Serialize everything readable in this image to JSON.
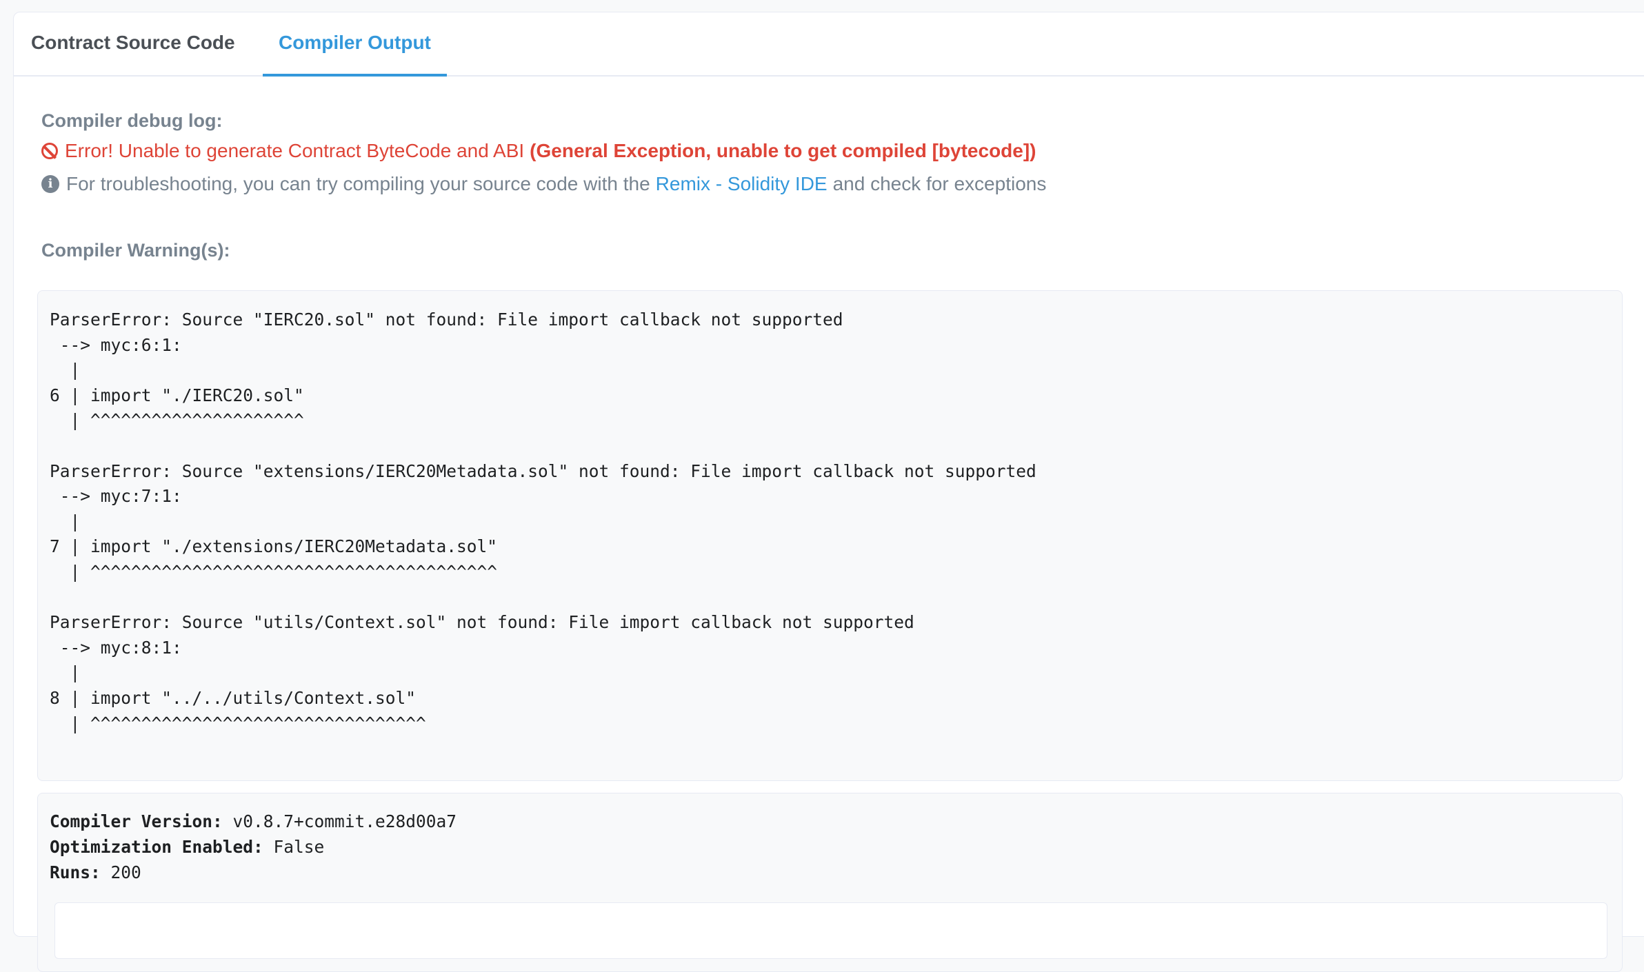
{
  "tabs": [
    {
      "label": "Contract Source Code"
    },
    {
      "label": "Compiler Output"
    }
  ],
  "debug": {
    "heading": "Compiler debug log:",
    "error_text": "Error! Unable to generate Contract ByteCode and ABI",
    "error_detail": "(General Exception, unable to get compiled [bytecode])",
    "info_prefix": "For troubleshooting, you can try compiling your source code with the",
    "info_link": "Remix - Solidity IDE",
    "info_suffix": "and check for exceptions"
  },
  "warnings": {
    "heading": "Compiler Warning(s):",
    "log": "ParserError: Source \"IERC20.sol\" not found: File import callback not supported\n --> myc:6:1:\n  |\n6 | import \"./IERC20.sol\"\n  | ^^^^^^^^^^^^^^^^^^^^^\n\nParserError: Source \"extensions/IERC20Metadata.sol\" not found: File import callback not supported\n --> myc:7:1:\n  |\n7 | import \"./extensions/IERC20Metadata.sol\"\n  | ^^^^^^^^^^^^^^^^^^^^^^^^^^^^^^^^^^^^^^^^\n\nParserError: Source \"utils/Context.sol\" not found: File import callback not supported\n --> myc:8:1:\n  |\n8 | import \"../../utils/Context.sol\"\n  | ^^^^^^^^^^^^^^^^^^^^^^^^^^^^^^^^^"
  },
  "compiler": {
    "version_label": "Compiler Version:",
    "version_value": " v0.8.7+commit.e28d00a7",
    "optimization_label": "Optimization Enabled:",
    "optimization_value": " False",
    "runs_label": "Runs:",
    "runs_value": " 200"
  },
  "colors": {
    "accent": "#3498db",
    "error": "#de4437",
    "muted": "#77838f"
  }
}
